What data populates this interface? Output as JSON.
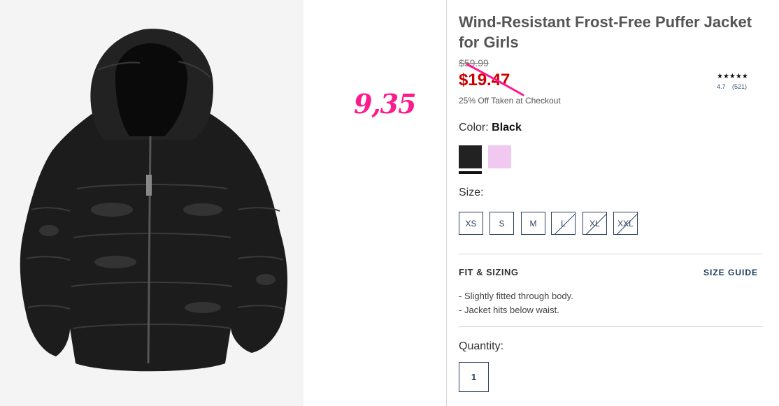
{
  "product": {
    "title": "Wind-Resistant Frost-Free Puffer Jacket for Girls",
    "image_alt": "black puffer jacket"
  },
  "annotation": {
    "price": "9,35",
    "color": "#ff1a8c"
  },
  "pricing": {
    "original": "$59.99",
    "sale": "$19.47",
    "promo": "25% Off Taken at Checkout",
    "sale_color": "#cc0000"
  },
  "rating": {
    "stars": "★★★★★",
    "score": "4.7",
    "count": "(521)"
  },
  "color": {
    "label": "Color:",
    "selected": "Black",
    "swatches": [
      {
        "name": "Black",
        "hex": "#222222"
      },
      {
        "name": "Pink",
        "hex": "#f0c8f0"
      }
    ]
  },
  "size": {
    "label": "Size:",
    "options": [
      {
        "label": "XS",
        "available": true
      },
      {
        "label": "S",
        "available": true
      },
      {
        "label": "M",
        "available": true
      },
      {
        "label": "L",
        "available": false
      },
      {
        "label": "XL",
        "available": false
      },
      {
        "label": "XXL",
        "available": false
      }
    ]
  },
  "fit": {
    "heading": "FIT & SIZING",
    "size_guide": "SIZE GUIDE",
    "items": [
      "Slightly fitted through body.",
      "Jacket hits below waist."
    ]
  },
  "quantity": {
    "label": "Quantity:",
    "value": "1"
  }
}
